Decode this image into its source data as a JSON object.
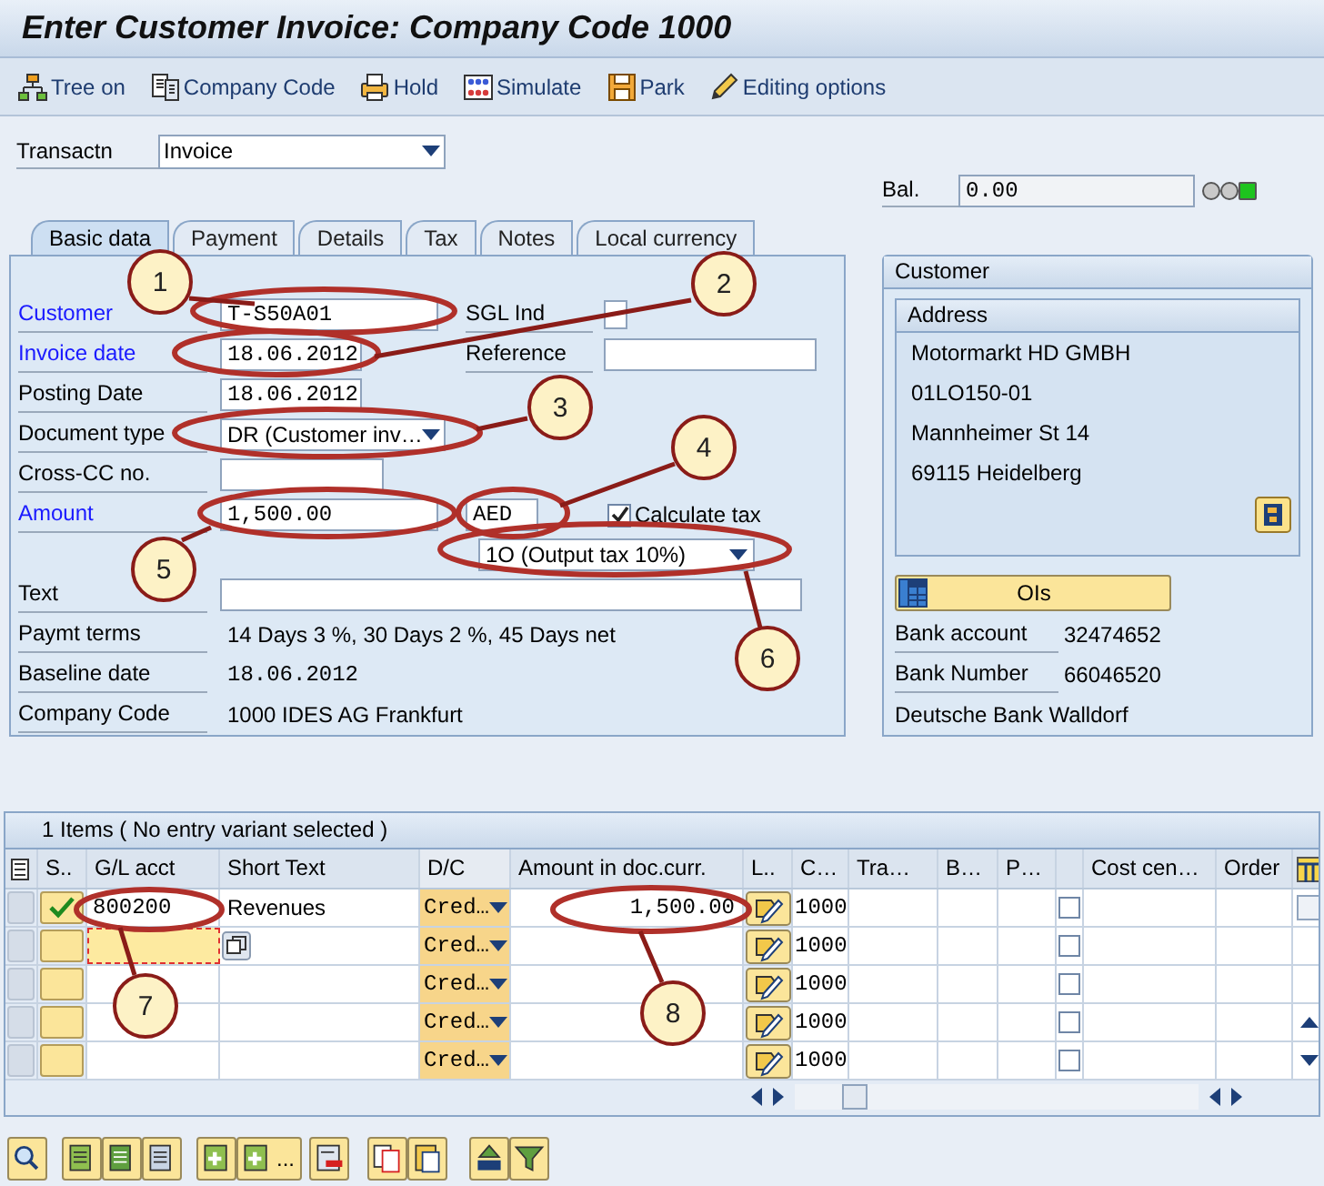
{
  "window": {
    "title": "Enter Customer Invoice: Company Code 1000"
  },
  "toolbar": [
    {
      "kind": "tree",
      "label": "Tree on"
    },
    {
      "kind": "company",
      "label": "Company Code"
    },
    {
      "kind": "hold",
      "label": "Hold"
    },
    {
      "kind": "simulate",
      "label": "Simulate"
    },
    {
      "kind": "park",
      "label": "Park"
    },
    {
      "kind": "edit",
      "label": "Editing options"
    }
  ],
  "transaction": {
    "label": "Transactn",
    "value": "Invoice"
  },
  "balance": {
    "label": "Bal.",
    "value": "0.00",
    "lights": [
      {
        "color": "#c9c9c9"
      },
      {
        "color": "#c9c9c9"
      },
      {
        "color": "#1ec41e"
      }
    ]
  },
  "tabs": [
    {
      "label": "Basic data",
      "selected": true
    },
    {
      "label": "Payment",
      "selected": false
    },
    {
      "label": "Details",
      "selected": false
    },
    {
      "label": "Tax",
      "selected": false
    },
    {
      "label": "Notes",
      "selected": false
    },
    {
      "label": "Local currency",
      "selected": false
    }
  ],
  "basic_data": {
    "customer": {
      "label": "Customer",
      "link": true,
      "value": "T-S50A01"
    },
    "sgl_ind": {
      "label": "SGL Ind"
    },
    "invoice_date": {
      "label": "Invoice date",
      "link": true,
      "value": "18.06.2012"
    },
    "reference": {
      "label": "Reference"
    },
    "posting_date": {
      "label": "Posting Date",
      "link": false,
      "value": "18.06.2012"
    },
    "document_type": {
      "label": "Document type",
      "link": false,
      "value": "DR (Customer inv…"
    },
    "cross_cc": {
      "label": "Cross-CC no.",
      "link": false
    },
    "amount": {
      "label": "Amount",
      "link": true,
      "value": "1,500.00"
    },
    "currency": "AED",
    "calculate_tax": {
      "label": "Calculate tax",
      "checked": true
    },
    "tax_code": "1O (Output tax 10%)",
    "text": {
      "label": "Text",
      "link": false
    },
    "payment_terms": {
      "label": "Paymt terms",
      "value": "14 Days 3 %, 30 Days 2 %, 45 Days net"
    },
    "baseline_date": {
      "label": "Baseline date",
      "value": "18.06.2012"
    },
    "company_code": {
      "label": "Company Code",
      "value": "1000 IDES AG Frankfurt"
    }
  },
  "customer_panel": {
    "title": "Customer",
    "address": {
      "title": "Address",
      "lines": [
        "Motormarkt HD GMBH",
        "01LO150-01",
        "Mannheimer St 14",
        "69115 Heidelberg"
      ]
    },
    "open_items_button": "OIs",
    "bank_account": {
      "label": "Bank account",
      "value": "32474652"
    },
    "bank_number": {
      "label": "Bank Number",
      "value": "66046520"
    },
    "bank_name": "Deutsche Bank Walldorf"
  },
  "items": {
    "title": "1 Items ( No entry variant selected )",
    "columns": [
      "S..",
      "G/L acct",
      "Short Text",
      "D/C",
      "Amount in doc.curr.",
      "L..",
      "C…",
      "Tra…",
      "B…",
      "P…",
      "Cost cen…",
      "Order"
    ],
    "rows": [
      {
        "status_ok": true,
        "focused": false,
        "gl_account": "800200",
        "short_text": "Revenues",
        "dc": "Cred…",
        "amount": "1,500.00",
        "company": "1000",
        "checked": false
      },
      {
        "status_ok": false,
        "focused": true,
        "dc": "Cred…",
        "company": "1000",
        "checked": false
      },
      {
        "status_ok": false,
        "focused": false,
        "dc": "Cred…",
        "company": "1000",
        "checked": false
      },
      {
        "status_ok": false,
        "focused": false,
        "dc": "Cred…",
        "company": "1000",
        "checked": false
      },
      {
        "status_ok": false,
        "focused": false,
        "dc": "Cred…",
        "company": "1000",
        "checked": false
      }
    ]
  },
  "bottom_toolbar": {
    "more_label": "..."
  },
  "callouts": [
    {
      "number": "1"
    },
    {
      "number": "2"
    },
    {
      "number": "3"
    },
    {
      "number": "4"
    },
    {
      "number": "5"
    },
    {
      "number": "6"
    },
    {
      "number": "7"
    },
    {
      "number": "8"
    }
  ]
}
